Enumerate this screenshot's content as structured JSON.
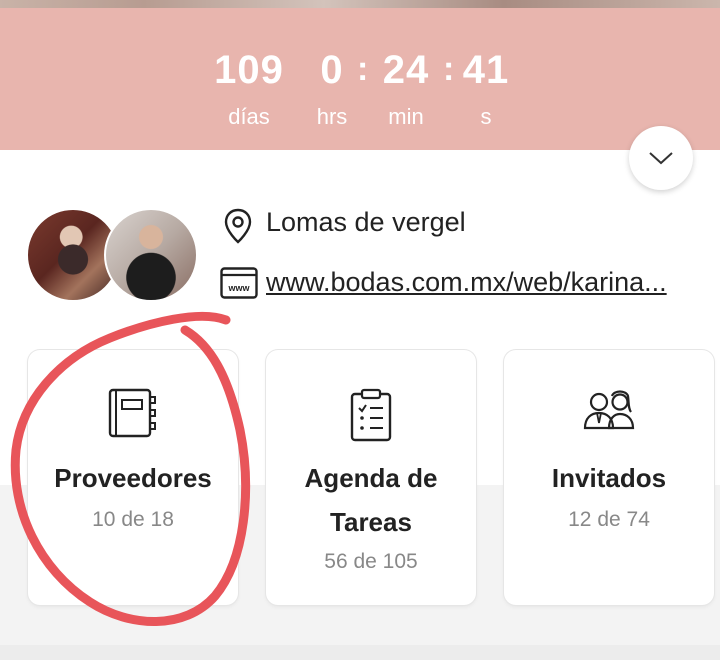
{
  "countdown": {
    "days": "109",
    "days_label": "días",
    "hours": "0",
    "hours_label": "hrs",
    "minutes": "24",
    "minutes_label": "min",
    "seconds": "41",
    "seconds_label": "s",
    "separator": ":"
  },
  "event": {
    "location": "Lomas de vergel",
    "website": "www.bodas.com.mx/web/karina...",
    "web_icon_text": "www"
  },
  "cards": [
    {
      "title": "Proveedores",
      "count": "10 de 18"
    },
    {
      "title_line1": "Agenda de",
      "title_line2": "Tareas",
      "count": "56 de 105"
    },
    {
      "title": "Invitados",
      "count": "12 de 74"
    }
  ],
  "annotation_color": "#e8555a",
  "accent_color": "#e8b5ae"
}
